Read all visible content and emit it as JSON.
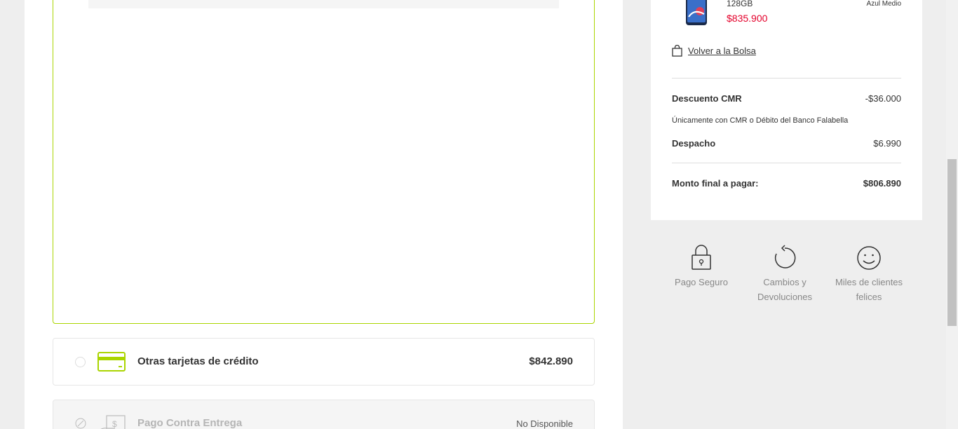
{
  "payment": {
    "other_cards": {
      "label": "Otras tarjetas de crédito",
      "price": "$842.890"
    },
    "cash_on_delivery": {
      "label": "Pago Contra Entrega",
      "status": "No Disponible"
    }
  },
  "summary": {
    "product": {
      "storage": "128GB",
      "price": "$835.900",
      "color": "Azul Medio"
    },
    "back_link": "Volver a la Bolsa",
    "discount": {
      "label": "Descuento CMR",
      "value": "-$36.000"
    },
    "discount_note": "Únicamente con CMR o Débito del Banco Falabella",
    "shipping": {
      "label": "Despacho",
      "value": "$6.990"
    },
    "total": {
      "label": "Monto final a pagar:",
      "value": "$806.890"
    }
  },
  "benefits": [
    {
      "label": "Pago Seguro",
      "icon": "lock-icon"
    },
    {
      "label": "Cambios y Devoluciones",
      "icon": "return-arrow-icon"
    },
    {
      "label": "Miles de clientes felices",
      "icon": "smiley-icon"
    }
  ],
  "colors": {
    "accent": "#aad500",
    "price_red": "#e4002b"
  }
}
